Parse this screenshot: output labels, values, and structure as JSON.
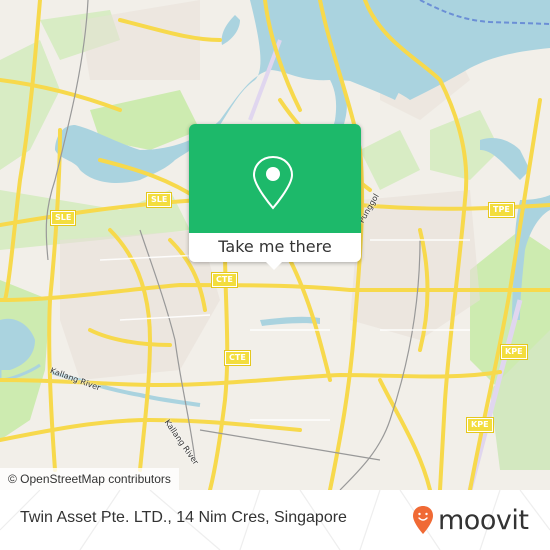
{
  "map": {
    "road_shields": [
      {
        "label": "SLE"
      },
      {
        "label": "SLE"
      },
      {
        "label": "TPE"
      },
      {
        "label": "CTE"
      },
      {
        "label": "CTE"
      },
      {
        "label": "KPE"
      },
      {
        "label": "KPE"
      }
    ],
    "road_labels": [
      {
        "label": "Kallang River"
      },
      {
        "label": "Kallang River"
      },
      {
        "label": "Punggol"
      }
    ],
    "attribution": "© OpenStreetMap contributors",
    "colors": {
      "water": "#aad3df",
      "park": "#cdebb0",
      "land": "#f2efe9",
      "road": "#f7e26b",
      "popup_green": "#1db96a"
    }
  },
  "popup": {
    "icon": "location-pin-icon",
    "button_label": "Take me there"
  },
  "footer": {
    "place_name": "Twin Asset Pte. LTD., 14 Nim Cres, Singapore",
    "brand": "moovit",
    "brand_color": "#f06a35"
  }
}
